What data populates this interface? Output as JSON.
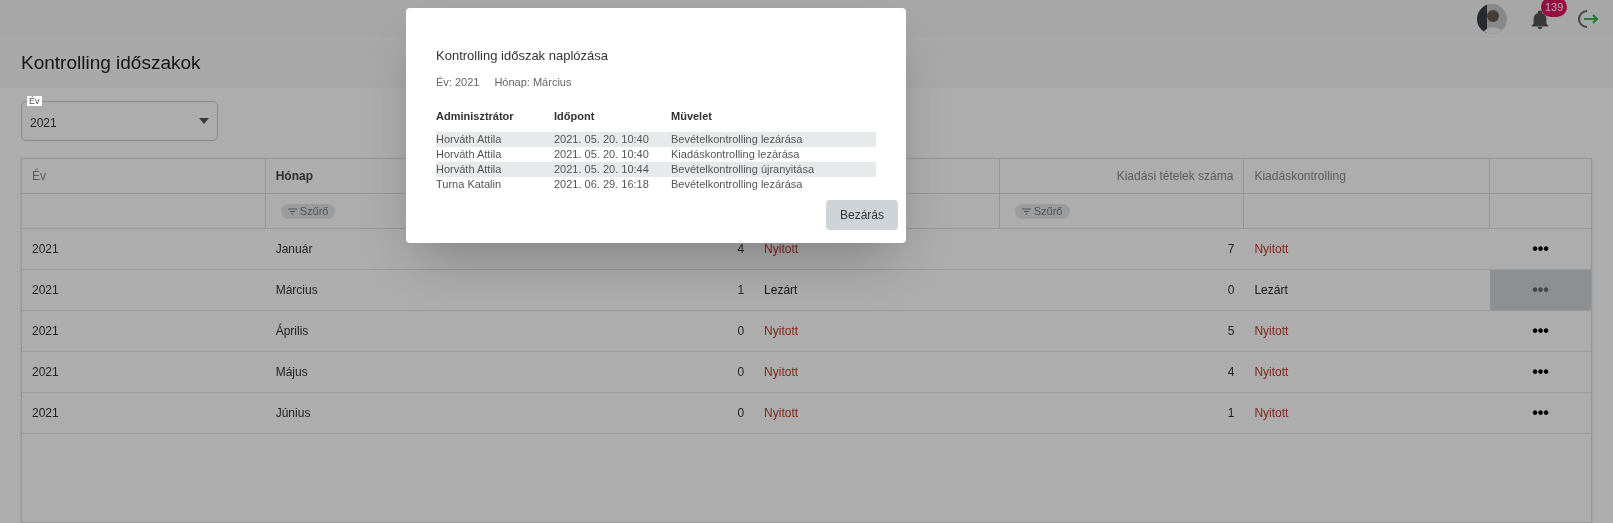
{
  "header": {
    "notification_count": "139"
  },
  "page": {
    "title": "Kontrolling időszakok"
  },
  "year_select": {
    "label": "Év",
    "value": "2021"
  },
  "table": {
    "columns": [
      {
        "label": "Év"
      },
      {
        "label": "Hónap",
        "filter": "Szűrő"
      },
      {},
      {},
      {
        "label": "Kiadási tételek száma",
        "filter": "Szűrő"
      },
      {
        "label": "Kiadáskontrolling"
      },
      {}
    ],
    "rows": [
      {
        "year": "2021",
        "month": "Január",
        "income_count": "4",
        "income_open": true,
        "income_status": "Nyitott",
        "expense_count": "7",
        "expense_open": true,
        "expense_status": "Nyitott",
        "actions": "•••",
        "selected": false
      },
      {
        "year": "2021",
        "month": "Március",
        "income_count": "1",
        "income_open": false,
        "income_status": "Lezárt",
        "expense_count": "0",
        "expense_open": false,
        "expense_status": "Lezárt",
        "actions": "•••",
        "selected": true
      },
      {
        "year": "2021",
        "month": "Április",
        "income_count": "0",
        "income_open": true,
        "income_status": "Nyitott",
        "expense_count": "5",
        "expense_open": true,
        "expense_status": "Nyitott",
        "actions": "•••",
        "selected": false
      },
      {
        "year": "2021",
        "month": "Május",
        "income_count": "0",
        "income_open": true,
        "income_status": "Nyitott",
        "expense_count": "4",
        "expense_open": true,
        "expense_status": "Nyitott",
        "actions": "•••",
        "selected": false
      },
      {
        "year": "2021",
        "month": "Június",
        "income_count": "0",
        "income_open": true,
        "income_status": "Nyitott",
        "expense_count": "1",
        "expense_open": true,
        "expense_status": "Nyitott",
        "actions": "•••",
        "selected": false
      }
    ]
  },
  "dialog": {
    "title": "Kontrolling időszak naplózása",
    "year": "Év: 2021",
    "month": "Hónap: Március",
    "columns": [
      "Adminisztrátor",
      "Időpont",
      "Müvelet"
    ],
    "rows": [
      [
        "Horváth Attila",
        "2021. 05. 20. 10:40",
        "Bevételkontrolling lezárása"
      ],
      [
        "Horváth Attila",
        "2021. 05. 20. 10:40",
        "Kiadáskontrolling lezárása"
      ],
      [
        "Horváth Attila",
        "2021. 05. 20. 10:44",
        "Bevételkontrolling újranyitása"
      ],
      [
        "Turna Katalin",
        "2021. 06. 29. 16:18",
        "Bevételkontrolling lezárása"
      ]
    ],
    "close_button": "Bezárás"
  }
}
